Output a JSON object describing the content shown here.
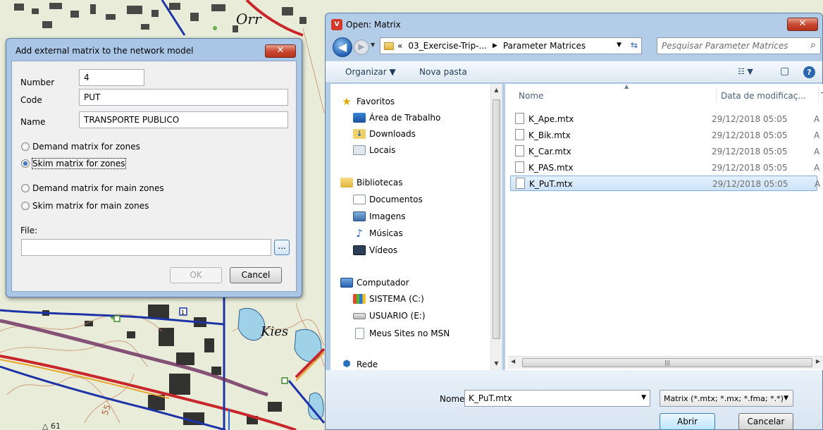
{
  "map": {
    "labels": [
      "Orr",
      "Kies",
      "1",
      "55",
      "△ 61"
    ]
  },
  "add_dialog": {
    "title": "Add external matrix to the network model",
    "close_glyph": "✕",
    "number_label": "Number",
    "number_value": "4",
    "code_label": "Code",
    "code_value": "PUT",
    "name_label": "Name",
    "name_value": "TRANSPORTE PUBLICO",
    "radios": [
      {
        "label": "Demand matrix for zones",
        "selected": false
      },
      {
        "label": "Skim matrix for zones",
        "selected": true
      },
      {
        "label": "Demand matrix for main zones",
        "selected": false
      },
      {
        "label": "Skim matrix for main zones",
        "selected": false
      }
    ],
    "file_label": "File:",
    "file_value": "",
    "browse_label": "...",
    "ok_label": "OK",
    "cancel_label": "Cancel"
  },
  "open_dialog": {
    "app_icon": "V",
    "title": "Open: Matrix",
    "close_glyph": "✕",
    "address": {
      "prefix": "«",
      "segments": [
        "03_Exercise-Trip-...",
        "Parameter Matrices"
      ],
      "separator": "▶"
    },
    "search_placeholder": "Pesquisar Parameter Matrices",
    "toolbar": {
      "organize_label": "Organizar ▼",
      "new_folder_label": "Nova pasta",
      "view_glyph": "☷ ▼",
      "help_glyph": "?"
    },
    "nav": {
      "favorites_title": "Favoritos",
      "favorites": [
        "Área de Trabalho",
        "Downloads",
        "Locais"
      ],
      "libraries_title": "Bibliotecas",
      "libraries": [
        "Documentos",
        "Imagens",
        "Músicas",
        "Vídeos"
      ],
      "computer_title": "Computador",
      "drives": [
        "SISTEMA (C:)",
        "USUARIO (E:)",
        "Meus Sites no MSN"
      ],
      "network_title": "Rede"
    },
    "columns": {
      "name": "Nome",
      "date": "Data de modificaç...",
      "type": "T"
    },
    "files": [
      {
        "name": "K_Ape.mtx",
        "date": "29/12/2018 05:05",
        "type": "A",
        "selected": false
      },
      {
        "name": "K_Bik.mtx",
        "date": "29/12/2018 05:05",
        "type": "A",
        "selected": false
      },
      {
        "name": "K_Car.mtx",
        "date": "29/12/2018 05:05",
        "type": "A",
        "selected": false
      },
      {
        "name": "K_PAS.mtx",
        "date": "29/12/2018 05:05",
        "type": "A",
        "selected": false
      },
      {
        "name": "K_PuT.mtx",
        "date": "29/12/2018 05:05",
        "type": "A",
        "selected": true
      }
    ],
    "filename_label": "Nome:",
    "filename_value": "K_PuT.mtx",
    "filter_value": "Matrix (*.mtx; *.mx; *.fma; *.*)",
    "open_label": "Abrir",
    "cancel_label": "Cancelar"
  },
  "colors": {
    "map_paper": "#e8ecd9",
    "map_road_red": "#c8262a",
    "map_road_blue": "#1d34a8",
    "dialog_frame": "#a9c6e6",
    "selection": "#cde3f9"
  }
}
